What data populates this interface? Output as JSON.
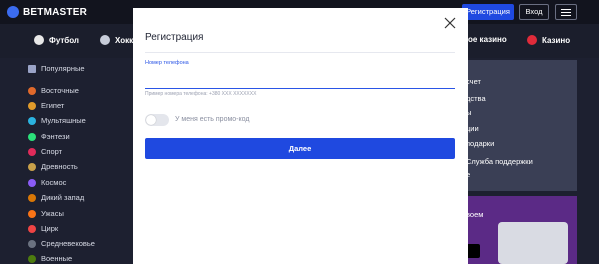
{
  "header": {
    "logo_text": "BETMASTER",
    "register_label": "Регистрация",
    "login_label": "Вход"
  },
  "nav": {
    "items": [
      {
        "label": "Футбол",
        "icon": "football-icon"
      },
      {
        "label": "Хокк",
        "icon": "hockey-icon"
      },
      {
        "label": "ое казино",
        "icon": "casino-icon"
      },
      {
        "label": "Казино",
        "icon": "casino-chip-icon"
      }
    ]
  },
  "sidebar": {
    "items": [
      {
        "label": "Популярные",
        "icon": "popular-icon",
        "color": "#9aa3c7"
      },
      {
        "label": "Восточные",
        "icon": "oriental-icon",
        "color": "#e0692b"
      },
      {
        "label": "Египет",
        "icon": "egypt-icon",
        "color": "#e09b2b"
      },
      {
        "label": "Мультяшные",
        "icon": "cartoon-icon",
        "color": "#2bb3e0"
      },
      {
        "label": "Фэнтези",
        "icon": "fantasy-icon",
        "color": "#2be07a"
      },
      {
        "label": "Спорт",
        "icon": "sport-icon",
        "color": "#e02b5a"
      },
      {
        "label": "Древность",
        "icon": "antiquity-icon",
        "color": "#c9a14a"
      },
      {
        "label": "Космос",
        "icon": "space-icon",
        "color": "#8b5cf6"
      },
      {
        "label": "Дикий запад",
        "icon": "wild-west-icon",
        "color": "#d97706"
      },
      {
        "label": "Ужасы",
        "icon": "horror-icon",
        "color": "#f97316"
      },
      {
        "label": "Цирк",
        "icon": "circus-icon",
        "color": "#ef4444"
      },
      {
        "label": "Средневековье",
        "icon": "medieval-icon",
        "color": "#6b7280"
      },
      {
        "label": "Военные",
        "icon": "military-icon",
        "color": "#4d7c0f"
      }
    ]
  },
  "right_panel": {
    "lines": [
      "счет",
      "дства",
      "ы",
      "ции",
      "подарки",
      "Служба поддержки",
      "е"
    ],
    "promo_text": "воем"
  },
  "modal": {
    "title": "Регистрация",
    "phone_label": "Номер телефона",
    "phone_value": "",
    "phone_hint": "Пример номера телефона: +380 XXX XXXXXXX",
    "promo_toggle_label": "У меня есть промо-код",
    "promo_toggle_on": false,
    "submit_label": "Далее"
  },
  "colors": {
    "accent": "#1f49e0",
    "background": "#1d2030",
    "modal_bg": "#ffffff"
  }
}
